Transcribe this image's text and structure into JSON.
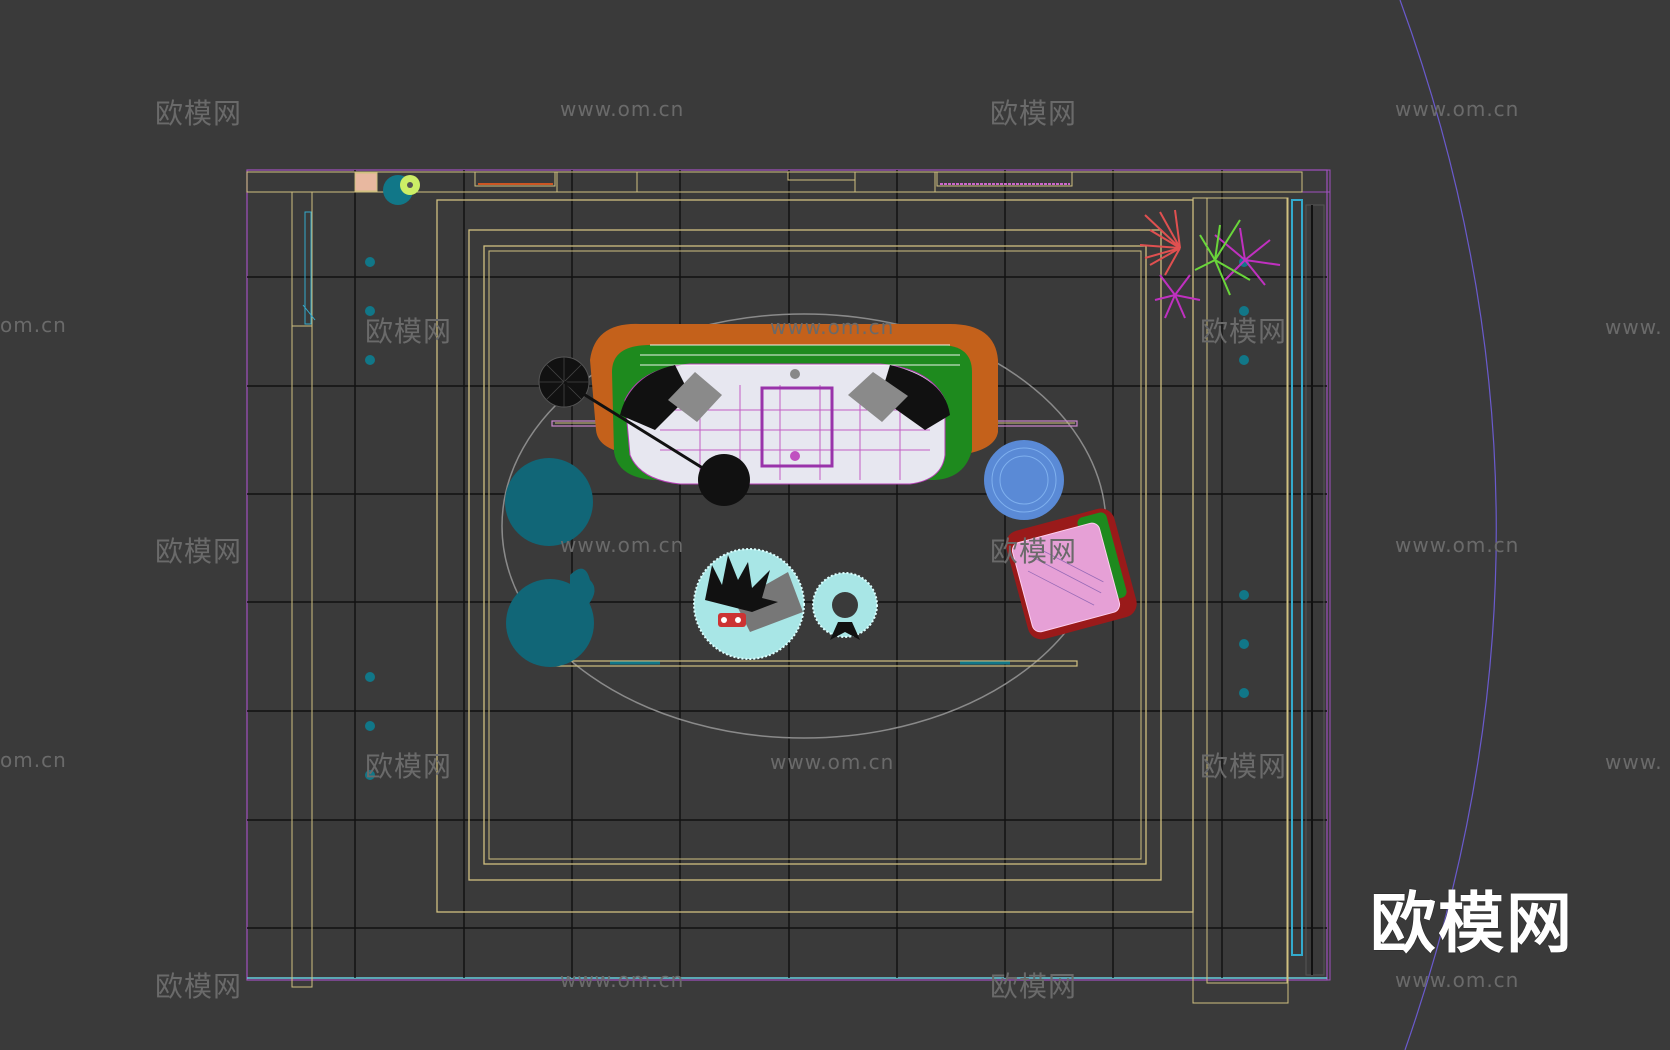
{
  "viewport": {
    "background": "#3a3a3a",
    "render_mode": "wireframe-top-view"
  },
  "watermark": {
    "brand_text": "欧模网",
    "url_text": "www.om.cn",
    "url_partial_text": "om.cn",
    "url_partial_right_text": "www.",
    "color": "#6a6a6a"
  },
  "logo": {
    "text": "欧模网",
    "color": "#ffffff"
  },
  "scene_objects": [
    {
      "name": "sofa",
      "colors": [
        "#c4611b",
        "#1e8a1e",
        "#ffffff",
        "#b43fb4"
      ]
    },
    {
      "name": "area-rug",
      "colors": [
        "#8a8a8a"
      ]
    },
    {
      "name": "coffee-table",
      "colors": [
        "#a8e6e6",
        "#111111",
        "#777777"
      ]
    },
    {
      "name": "side-table-ring",
      "colors": [
        "#a8e6e6"
      ]
    },
    {
      "name": "armchair",
      "colors": [
        "#9a1a1a",
        "#e6a0d6",
        "#1e8a1e"
      ]
    },
    {
      "name": "round-stool",
      "colors": [
        "#5a8ad6"
      ]
    },
    {
      "name": "pouf",
      "colors": [
        "#116677"
      ]
    },
    {
      "name": "plant-pot",
      "colors": [
        "#116677"
      ]
    },
    {
      "name": "floor-lamp",
      "colors": [
        "#111111"
      ]
    },
    {
      "name": "potted-plant",
      "colors": [
        "#e05050",
        "#c030c0",
        "#6ad63a"
      ]
    }
  ]
}
